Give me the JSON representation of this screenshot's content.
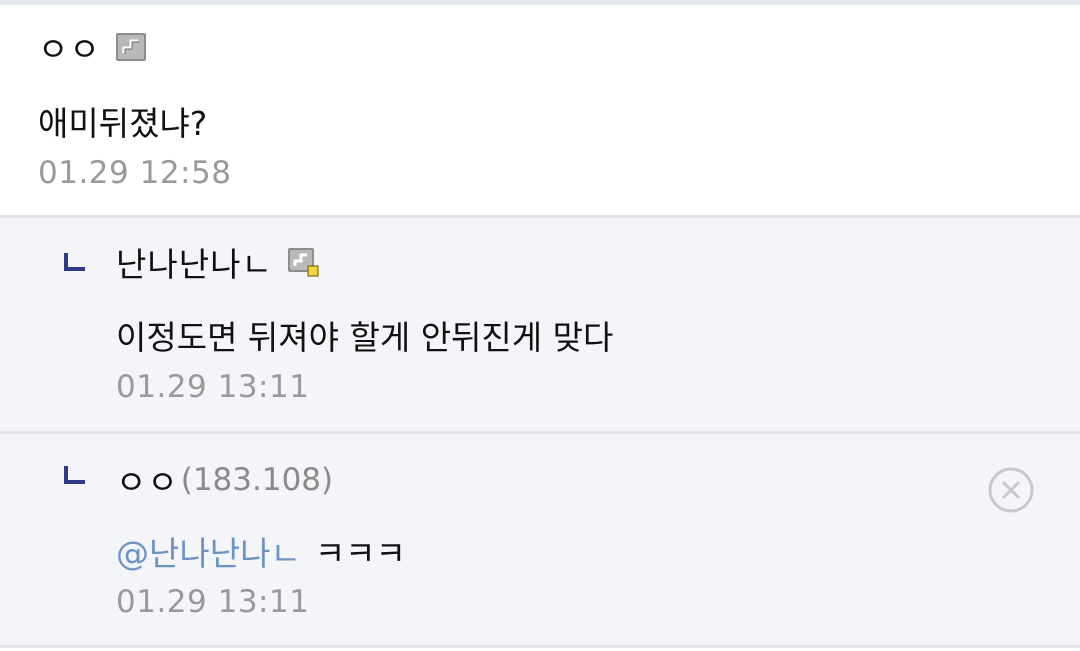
{
  "comments": [
    {
      "nickname": "ㅇㅇ",
      "body": "애미뒤졌냐?",
      "timestamp": "01.29 12:58"
    },
    {
      "nickname": "난나난나ㄴ",
      "body": "이정도면 뒤져야 할게 안뒤진게 맞다",
      "timestamp": "01.29 13:11"
    },
    {
      "nickname": "ㅇㅇ",
      "ip": "(183.108)",
      "mention": "@난나난나ㄴ",
      "body": "ㅋㅋㅋ",
      "timestamp": "01.29 13:11"
    }
  ],
  "colors": {
    "mention": "#6d93c4",
    "reply_marker": "#2d3a8c",
    "reply_background": "#f4f5f8",
    "divider": "#e3e4e8"
  },
  "icons": [
    "gallog-icon",
    "gallog-icon-fixed",
    "reply-arrow-icon",
    "delete-icon"
  ]
}
